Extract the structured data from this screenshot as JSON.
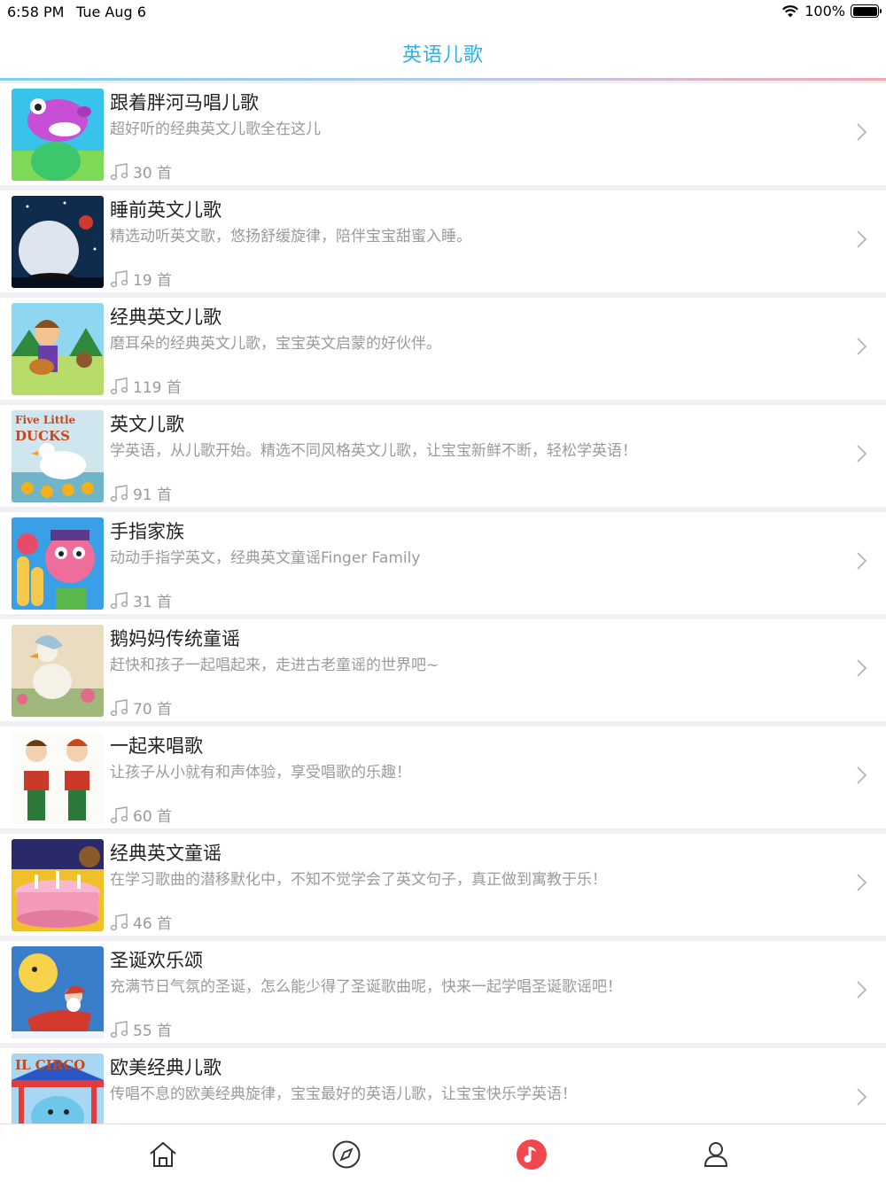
{
  "status_bar": {
    "time": "6:58 PM",
    "date": "Tue Aug 6",
    "battery": "100%",
    "icons": [
      "wifi-icon",
      "battery-icon"
    ]
  },
  "nav": {
    "title": "英语儿歌"
  },
  "colors": {
    "accent": "#2fb2e8",
    "active_tab": "#f0484e",
    "secondary_text": "#9a9a9a"
  },
  "count_icon": "music-note-icon",
  "playlists": [
    {
      "name": "跟着胖河马唱儿歌",
      "desc": "超好听的经典英文儿歌全在这儿",
      "count": "30 首",
      "thumb": "hippo"
    },
    {
      "name": "睡前英文儿歌",
      "desc": "精选动听英文歌，悠扬舒缓旋律，陪伴宝宝甜蜜入睡。",
      "count": "19 首",
      "thumb": "moon"
    },
    {
      "name": "经典英文儿歌",
      "desc": "磨耳朵的经典英文儿歌，宝宝英文启蒙的好伙伴。",
      "count": "119 首",
      "thumb": "guitar"
    },
    {
      "name": "英文儿歌",
      "desc": "学英语，从儿歌开始。精选不同风格英文儿歌，让宝宝新鲜不断，轻松学英语！",
      "count": "91 首",
      "thumb": "ducks",
      "thumb_text": [
        "Five Little",
        "DUCKS"
      ]
    },
    {
      "name": "手指家族",
      "desc": "动动手指学英文，经典英文童谣Finger Family",
      "count": "31 首",
      "thumb": "finger"
    },
    {
      "name": "鹅妈妈传统童谣",
      "desc": "赶快和孩子一起唱起来，走进古老童谣的世界吧~",
      "count": "70 首",
      "thumb": "goose"
    },
    {
      "name": "一起来唱歌",
      "desc": "让孩子从小就有和声体验，享受唱歌的乐趣！",
      "count": "60 首",
      "thumb": "carol"
    },
    {
      "name": "经典英文童谣",
      "desc": "在学习歌曲的潜移默化中，不知不觉学会了英文句子，真正做到寓教于乐！",
      "count": "46 首",
      "thumb": "cake"
    },
    {
      "name": "圣诞欢乐颂",
      "desc": "充满节日气氛的圣诞，怎么能少得了圣诞歌曲呢，快来一起学唱圣诞歌谣吧！",
      "count": "55 首",
      "thumb": "santa"
    },
    {
      "name": "欧美经典儿歌",
      "desc": "传唱不息的欧美经典旋律，宝宝最好的英语儿歌，让宝宝快乐学英语！",
      "count": "",
      "thumb": "circus",
      "thumb_text": [
        "IL CIRCO"
      ]
    }
  ],
  "tabs": [
    {
      "icon": "home-icon",
      "active": false
    },
    {
      "icon": "compass-icon",
      "active": false
    },
    {
      "icon": "music-icon",
      "active": true
    },
    {
      "icon": "user-icon",
      "active": false
    }
  ]
}
